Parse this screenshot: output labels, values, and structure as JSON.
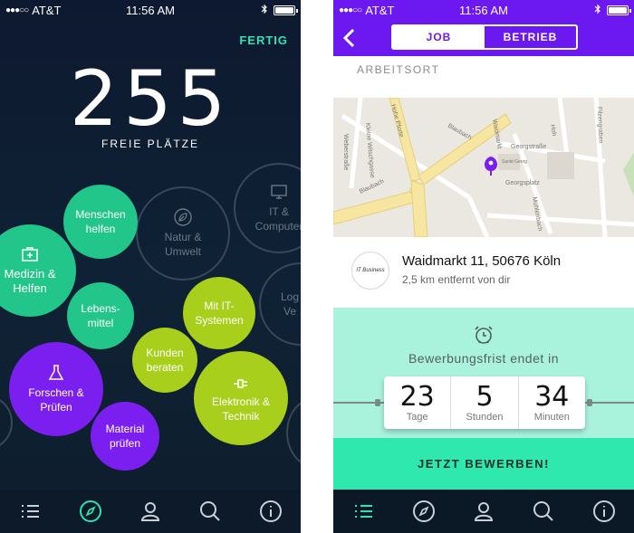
{
  "status_left": {
    "carrier": "AT&T",
    "time": "11:56 AM"
  },
  "status_right": {
    "carrier": "AT&T",
    "time": "11:56 AM"
  },
  "explore": {
    "done_label": "FERTIG",
    "free_count": "255",
    "free_label": "FREIE PLÄTZE",
    "bubbles": {
      "menschen": "Menschen\nhelfen",
      "natur": "Natur &\nUmwelt",
      "it": "IT &\nComputer",
      "medizin": "Medizin &\nHelfen",
      "lebensmittel": "Lebens-\nmittel",
      "mit_it": "Mit IT-\nSystemen",
      "logistik": "Log\nVe",
      "kunden": "Kunden\nberaten",
      "forschen": "Forschen &\nPrüfen",
      "elektronik": "Elektronik &\nTechnik",
      "material": "Material\nprüfen"
    },
    "colors": {
      "teal": "#22c58a",
      "lime": "#a8cf1b",
      "purple": "#7a1ff0",
      "accent": "#2fe3b0"
    }
  },
  "tabs": [
    "list-icon",
    "compass-icon",
    "person-icon",
    "search-icon",
    "info-icon"
  ],
  "detail": {
    "segments": {
      "job": "JOB",
      "betrieb": "BETRIEB"
    },
    "section_label": "ARBEITSORT",
    "map": {
      "streets": [
        "Blaubach",
        "Blaubach",
        "Hohe Pforte",
        "Georgstraße",
        "Georgsplatz",
        "Mühlenbach",
        "Waidmarkt",
        "Sankt Georg",
        "Weberstraße",
        "Kleine Witschgasse",
        "Hoh",
        "Filzengraben"
      ]
    },
    "logo_text": "IT Business",
    "address": "Waidmarkt 11, 50676 Köln",
    "distance": "2,5 km entfernt von dir",
    "deadline_label": "Bewerbungsfrist endet in",
    "countdown": [
      {
        "value": "23",
        "unit": "Tage"
      },
      {
        "value": "5",
        "unit": "Stunden"
      },
      {
        "value": "34",
        "unit": "Minuten"
      }
    ],
    "apply_label": "JETZT BEWERBEN!",
    "colors": {
      "brand": "#6b19f0",
      "mint": "#a9f3dd",
      "button": "#2ee8ad"
    }
  }
}
